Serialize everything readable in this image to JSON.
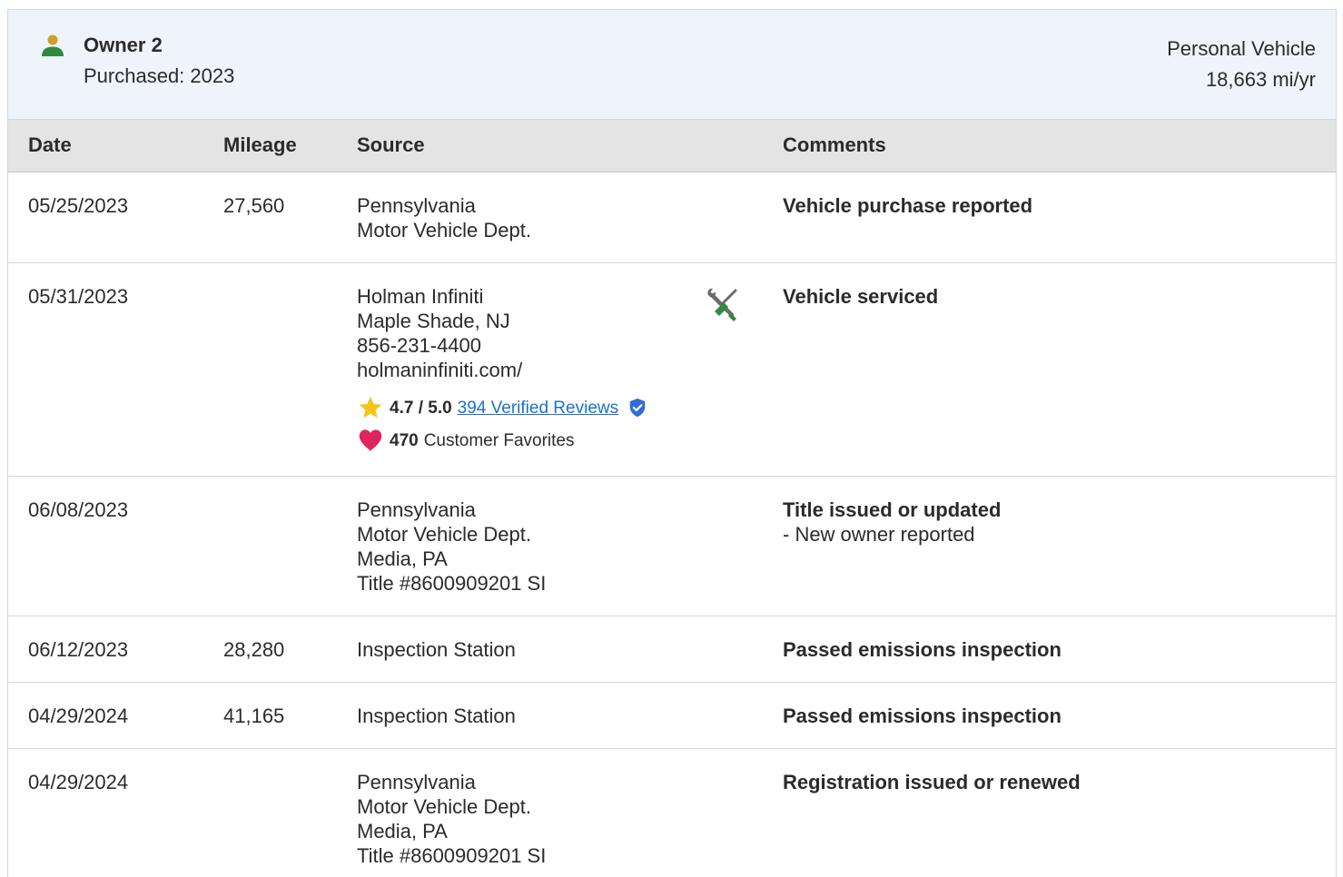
{
  "owner": {
    "name": "Owner 2",
    "purchased": "Purchased: 2023",
    "vehicle_type": "Personal Vehicle",
    "mileage_per_year": "18,663 mi/yr"
  },
  "table": {
    "headers": {
      "date": "Date",
      "mileage": "Mileage",
      "source": "Source",
      "comments": "Comments"
    },
    "rows": [
      {
        "date": "05/25/2023",
        "mileage": "27,560",
        "source": [
          "Pennsylvania",
          "Motor Vehicle Dept."
        ],
        "comment_title": "Vehicle purchase reported",
        "comment_detail": ""
      },
      {
        "date": "05/31/2023",
        "mileage": "",
        "source": [
          "Holman Infiniti",
          "Maple Shade, NJ",
          "856-231-4400",
          "holmaninfiniti.com/"
        ],
        "rating": "4.7 / 5.0",
        "reviews_link": "394 Verified Reviews",
        "favorites_count": "470",
        "favorites_label": "Customer Favorites",
        "service_icon": "tools-icon",
        "comment_title": "Vehicle serviced",
        "comment_detail": ""
      },
      {
        "date": "06/08/2023",
        "mileage": "",
        "source": [
          "Pennsylvania",
          "Motor Vehicle Dept.",
          "Media, PA",
          "Title #8600909201 SI"
        ],
        "comment_title": "Title issued or updated",
        "comment_detail": "- New owner reported"
      },
      {
        "date": "06/12/2023",
        "mileage": "28,280",
        "source": [
          "Inspection Station"
        ],
        "comment_title": "Passed emissions inspection",
        "comment_detail": ""
      },
      {
        "date": "04/29/2024",
        "mileage": "41,165",
        "source": [
          "Inspection Station"
        ],
        "comment_title": "Passed emissions inspection",
        "comment_detail": ""
      },
      {
        "date": "04/29/2024",
        "mileage": "",
        "source": [
          "Pennsylvania",
          "Motor Vehicle Dept.",
          "Media, PA",
          "Title #8600909201 SI"
        ],
        "comment_title": "Registration issued or renewed",
        "comment_detail": ""
      }
    ]
  },
  "colors": {
    "header_bg": "#eef4fa",
    "table_head_bg": "#e4e4e4",
    "link": "#1a73c8",
    "star": "#f5c518",
    "heart": "#e0245e",
    "verified": "#2f6fd6",
    "person_head": "#c9a227",
    "person_body": "#2e8b3e"
  }
}
